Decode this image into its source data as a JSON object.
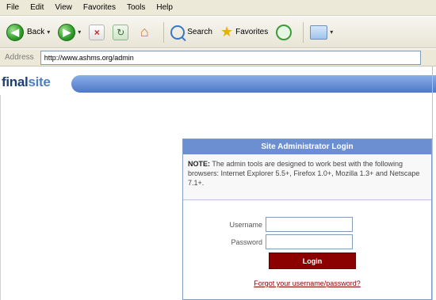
{
  "menu": {
    "items": [
      "File",
      "Edit",
      "View",
      "Favorites",
      "Tools",
      "Help"
    ]
  },
  "toolbar": {
    "back_label": "Back",
    "search_label": "Search",
    "favorites_label": "Favorites"
  },
  "address": {
    "label": "Address",
    "url": "http://www.ashms.org/admin"
  },
  "site": {
    "logo_part1": "fin",
    "logo_part2": "al",
    "logo_part3": "site"
  },
  "login": {
    "title": "Site Administrator Login",
    "note_label": "NOTE:",
    "note_text": "The admin tools are designed to work best with the following browsers: Internet Explorer 5.5+, Firefox 1.0+, Mozilla 1.3+ and Netscape 7.1+.",
    "username_label": "Username",
    "password_label": "Password",
    "username_value": "",
    "password_value": "",
    "button_label": "Login",
    "forgot_link": "Forgot your username/password?"
  },
  "colors": {
    "accent": "#6b8fd0",
    "button": "#8b0000"
  }
}
